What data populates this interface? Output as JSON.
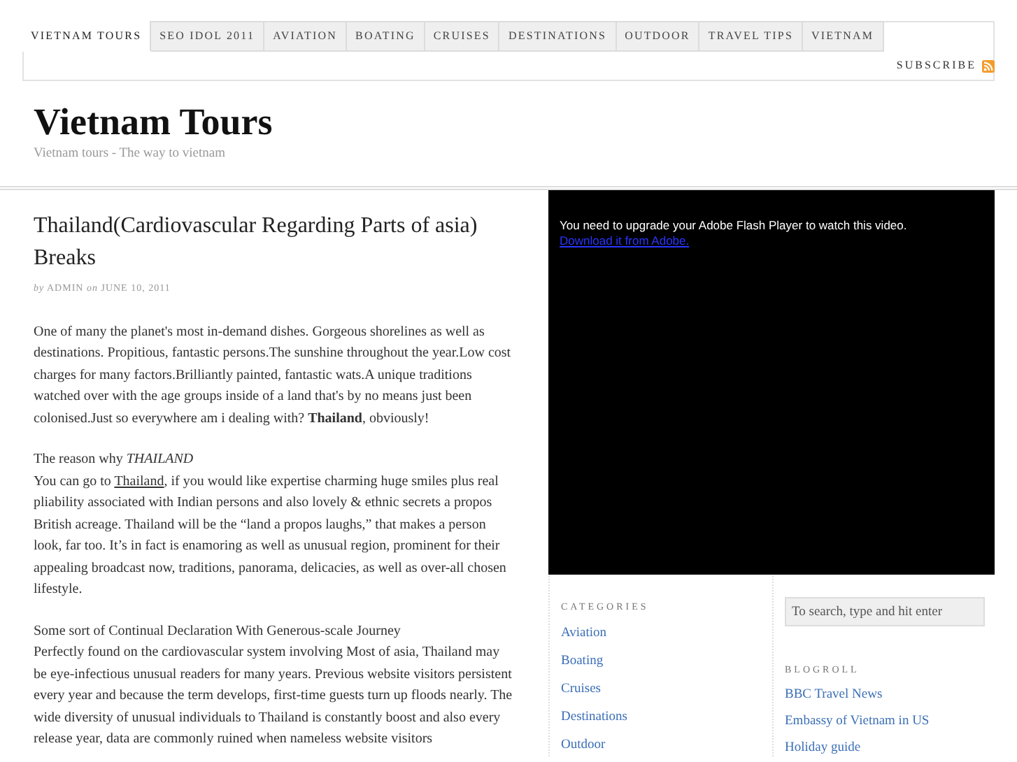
{
  "nav": {
    "tabs": [
      {
        "label": "VIETNAM TOURS",
        "selected": true
      },
      {
        "label": "SEO IDOL 2011",
        "selected": false
      },
      {
        "label": "AVIATION",
        "selected": false
      },
      {
        "label": "BOATING",
        "selected": false
      },
      {
        "label": "CRUISES",
        "selected": false
      },
      {
        "label": "DESTINATIONS",
        "selected": false
      },
      {
        "label": "OUTDOOR",
        "selected": false
      },
      {
        "label": "TRAVEL TIPS",
        "selected": false
      },
      {
        "label": "VIETNAM",
        "selected": false
      }
    ],
    "subscribe": "SUBSCRIBE"
  },
  "site": {
    "title": "Vietnam Tours",
    "tagline": "Vietnam tours - The way to vietnam"
  },
  "post": {
    "title": "Thailand(Cardiovascular Regarding Parts of asia) Breaks",
    "by": "by",
    "author": "ADMIN",
    "on": "on",
    "date": "JUNE 10, 2011",
    "intro": "One of many the planet's most in-demand dishes. Gorgeous shorelines as well as destinations. Propitious, fantastic persons.The sunshine throughout the year.Low cost charges for many factors.Brilliantly painted, fantastic wats.A unique traditions watched over with the age groups inside of a land that's by no means just been colonised.Just so everywhere am i dealing with? **Thailand**, obviously!",
    "sections": [
      {
        "heading": "The reason why *THAILAND*",
        "before": "You can go to ",
        "link": "Thailand",
        "after": ", if you would like expertise charming huge smiles plus real pliability associated with Indian persons and also lovely & ethnic secrets a propos British acreage. Thailand will be the “land a propos laughs,” that makes a person look, far too. It’s in fact is enamoring as well as unusual region, prominent for their appealing broadcast now, traditions, panorama, delicacies, as well as over-all chosen lifestyle."
      },
      {
        "heading": "Some sort of Continual Declaration With Generous-scale Journey",
        "before": "Perfectly found on the cardiovascular system involving Most of asia, Thailand may be eye-infectious unusual readers for many years. Previous website visitors persistent every year and because the term develops, first-time guests turn up floods nearly. The wide diversity of unusual individuals to Thailand is constantly boost and also every release year, data are commonly ruined when nameless website visitors"
      }
    ]
  },
  "video": {
    "message": "You need to upgrade your Adobe Flash Player to watch this video.",
    "link": "Download it from Adobe."
  },
  "categories": {
    "heading": "CATEGORIES",
    "items": [
      "Aviation",
      "Boating",
      "Cruises",
      "Destinations",
      "Outdoor"
    ]
  },
  "search": {
    "placeholder": "To search, type and hit enter"
  },
  "blogroll": {
    "heading": "BLOGROLL",
    "items": [
      "BBC Travel News",
      "Embassy of Vietnam in US",
      "Holiday guide"
    ]
  }
}
